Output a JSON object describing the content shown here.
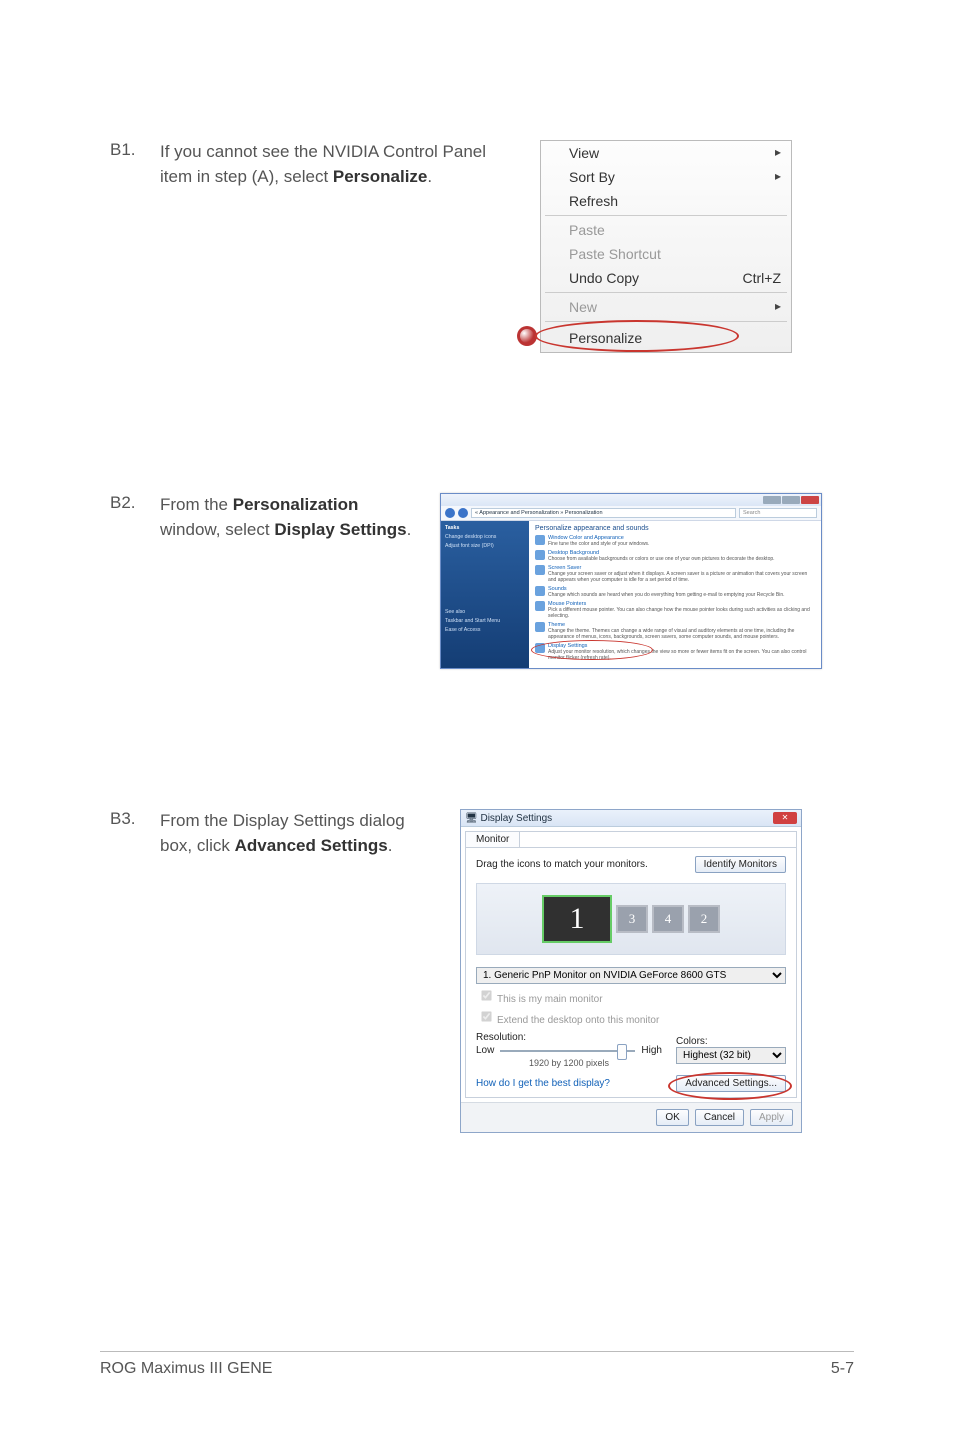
{
  "steps": {
    "b1": {
      "label": "B1.",
      "text_pre": "If you cannot see the NVIDIA Control Panel item in step (A), select ",
      "text_bold": "Personalize",
      "text_post": "."
    },
    "b2": {
      "label": "B2.",
      "text_pre1": "From the ",
      "text_bold1": "Personalization",
      "text_mid": " window, select ",
      "text_bold2": "Display Settings",
      "text_post": "."
    },
    "b3": {
      "label": "B3.",
      "text_pre": "From the Display Settings dialog box, click ",
      "text_bold": "Advanced Settings",
      "text_post": "."
    }
  },
  "context_menu": {
    "view": "View",
    "sort": "Sort By",
    "refresh": "Refresh",
    "paste": "Paste",
    "paste_shortcut": "Paste Shortcut",
    "undo": "Undo Copy",
    "undo_key": "Ctrl+Z",
    "new": "New",
    "personalize": "Personalize"
  },
  "personalization": {
    "breadcrumb": "« Appearance and Personalization » Personalization",
    "search": "Search",
    "sidebar_title": "Tasks",
    "sidebar_items": [
      "Change desktop icons",
      "Adjust font size (DPI)"
    ],
    "sidebar_lower": [
      "See also",
      "Taskbar and Start Menu",
      "Ease of Access"
    ],
    "heading": "Personalize appearance and sounds",
    "items": [
      {
        "title": "Window Color and Appearance",
        "desc": "Fine tune the color and style of your windows."
      },
      {
        "title": "Desktop Background",
        "desc": "Choose from available backgrounds or colors or use one of your own pictures to decorate the desktop."
      },
      {
        "title": "Screen Saver",
        "desc": "Change your screen saver or adjust when it displays. A screen saver is a picture or animation that covers your screen and appears when your computer is idle for a set period of time."
      },
      {
        "title": "Sounds",
        "desc": "Change which sounds are heard when you do everything from getting e-mail to emptying your Recycle Bin."
      },
      {
        "title": "Mouse Pointers",
        "desc": "Pick a different mouse pointer. You can also change how the mouse pointer looks during such activities as clicking and selecting."
      },
      {
        "title": "Theme",
        "desc": "Change the theme. Themes can change a wide range of visual and auditory elements at one time, including the appearance of menus, icons, backgrounds, screen savers, some computer sounds, and mouse pointers."
      },
      {
        "title": "Display Settings",
        "desc": "Adjust your monitor resolution, which changes the view so more or fewer items fit on the screen. You can also control monitor flicker (refresh rate)."
      }
    ]
  },
  "display_settings": {
    "title": "Display Settings",
    "tab": "Monitor",
    "drag": "Drag the icons to match your monitors.",
    "identify": "Identify Monitors",
    "monitor_numbers": [
      "1",
      "3",
      "4",
      "2"
    ],
    "device": "1. Generic PnP Monitor on NVIDIA GeForce 8600 GTS",
    "cb1": "This is my main monitor",
    "cb2": "Extend the desktop onto this monitor",
    "res_label": "Resolution:",
    "res_low": "Low",
    "res_high": "High",
    "res_value": "1920 by 1200 pixels",
    "colors_label": "Colors:",
    "colors_value": "Highest (32 bit)",
    "help_link": "How do I get the best display?",
    "advanced": "Advanced Settings...",
    "ok": "OK",
    "cancel": "Cancel",
    "apply": "Apply"
  },
  "footer": {
    "left": "ROG Maximus III GENE",
    "right": "5-7"
  }
}
